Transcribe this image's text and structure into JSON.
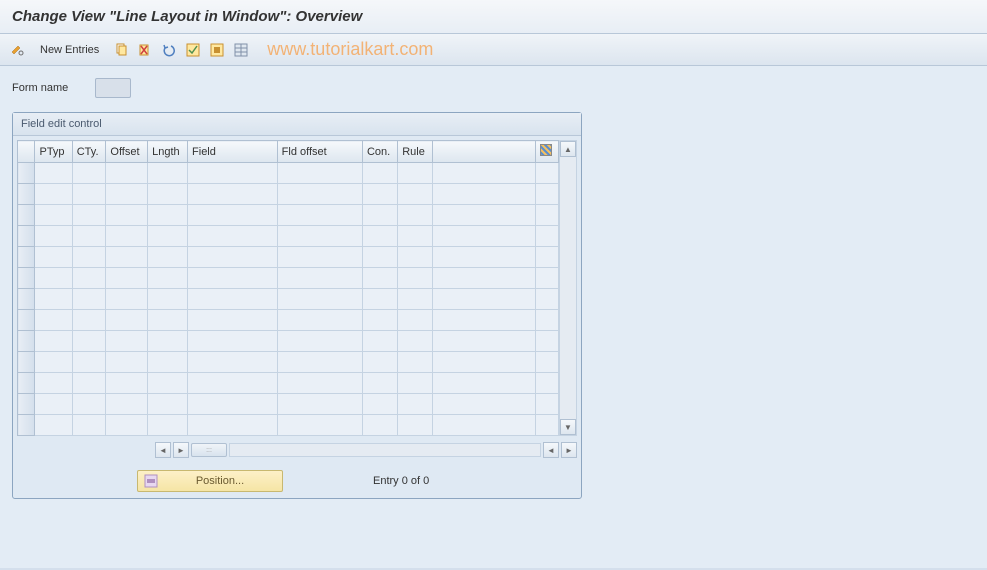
{
  "title": "Change View \"Line Layout in Window\": Overview",
  "toolbar": {
    "new_entries": "New Entries"
  },
  "watermark": "www.tutorialkart.com",
  "form": {
    "form_name_label": "Form name",
    "form_name_value": ""
  },
  "panel": {
    "title": "Field edit control",
    "columns": {
      "ptyp": "PTyp",
      "cty": "CTy.",
      "offset": "Offset",
      "lngth": "Lngth",
      "field": "Field",
      "fld_offset": "Fld offset",
      "con": "Con.",
      "rule": "Rule"
    },
    "row_count": 13
  },
  "footer": {
    "position_label": "Position...",
    "entry_text": "Entry 0 of 0"
  }
}
